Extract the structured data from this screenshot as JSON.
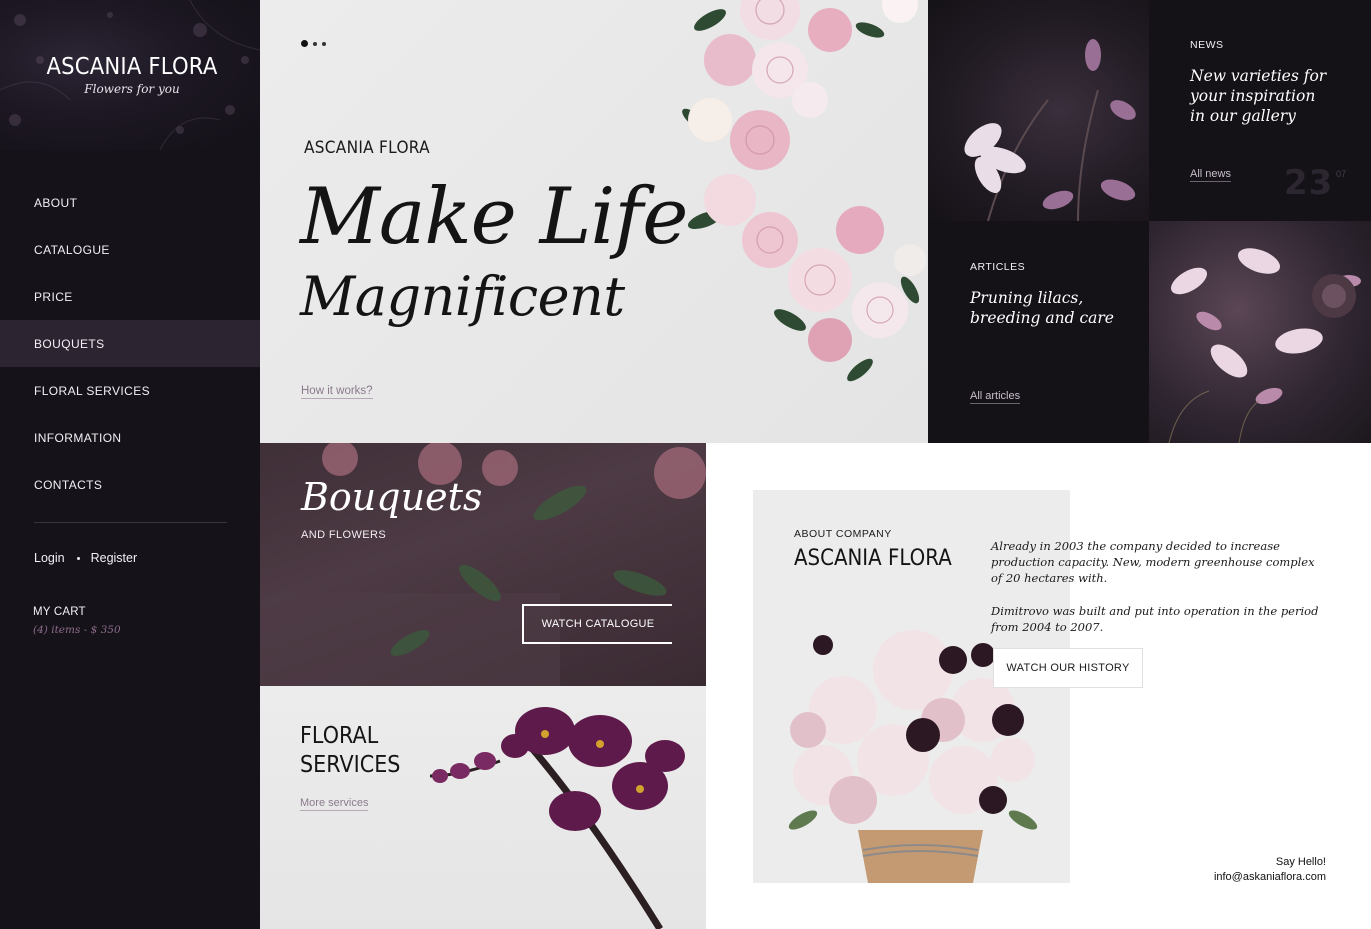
{
  "brand": {
    "title": "ASCANIA FLORA",
    "subtitle": "Flowers for you"
  },
  "nav": {
    "items": [
      {
        "label": "ABOUT"
      },
      {
        "label": "CATALOGUE"
      },
      {
        "label": "PRICE"
      },
      {
        "label": "BOUQUETS",
        "active": true
      },
      {
        "label": "FLORAL SERVICES"
      },
      {
        "label": "INFORMATION"
      },
      {
        "label": "CONTACTS"
      }
    ]
  },
  "auth": {
    "login": "Login",
    "register": "Register"
  },
  "cart": {
    "label": "MY CART",
    "info": "(4) items - $ 350"
  },
  "hero": {
    "brand": "ASCANIA FLORA",
    "title_line1": "Make Life",
    "title_line2": "Magnificent",
    "link": "How it works?"
  },
  "news": {
    "label": "NEWS",
    "headline": "New varieties for your inspiration in our gallery",
    "headline_lines": [
      "New varieties for",
      "your inspiration",
      "in our gallery"
    ],
    "link": "All news",
    "day": "23",
    "month": "07"
  },
  "articles": {
    "label": "ARTICLES",
    "headline_lines": [
      "Pruning lilacs,",
      "breeding and care"
    ],
    "link": "All articles"
  },
  "bouquets": {
    "title": "Bouquets",
    "subtitle": "AND FLOWERS",
    "button": "WATCH CATALOGUE"
  },
  "services": {
    "title_line1": "FLORAL",
    "title_line2": "SERVICES",
    "link": "More services"
  },
  "about": {
    "label": "ABOUT COMPANY",
    "title": "ASCANIA FLORA",
    "paragraph1": "Already in 2003 the company decided to increase production capacity. New, modern greenhouse complex of 20 hectares with.",
    "paragraph2": "Dimitrovo was built and put into operation in the period from 2004 to 2007.",
    "button": "WATCH OUR HISTORY"
  },
  "contact": {
    "greeting": "Say Hello!",
    "email": "info@askaniaflora.com"
  },
  "colors": {
    "sidebar_bg": "#151219",
    "nav_active_bg": "#2c2431",
    "accent_muted_purple": "#8e6c8b",
    "dark_tile_bg": "#141117",
    "light_bg": "#ececec"
  }
}
